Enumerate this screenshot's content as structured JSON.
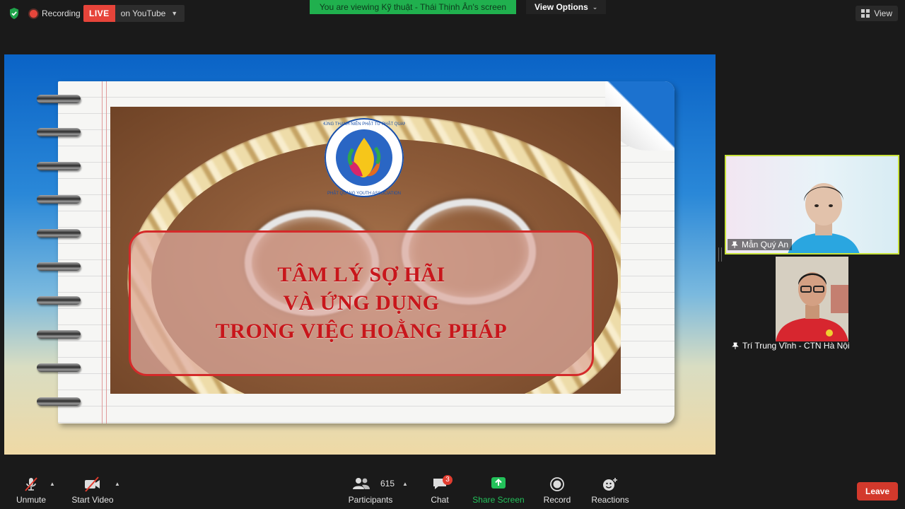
{
  "top_bar": {
    "recording_label": "Recording",
    "live_badge": "LIVE",
    "youtube_label": "on YouTube",
    "viewing_banner": "You are viewing Kỹ thuật - Thái Thịnh Ân's screen",
    "view_options": "View Options",
    "view_label": "View"
  },
  "slide": {
    "title_lines": [
      "TÂM LÝ SỢ HÃI",
      "VÀ ỨNG DỤNG",
      "TRONG VIỆC HOẰNG PHÁP"
    ],
    "logo_text_top": "CHÚNG THANH NIÊN PHẬT TỬ PHẬT QUANG",
    "logo_text_bottom": "PHẬT QUANG YOUTH ASSOCIATION"
  },
  "participants": [
    {
      "name": "Mẫn Quý An"
    },
    {
      "name": "Trí Trung Vĩnh - CTN Hà Nội"
    }
  ],
  "toolbar": {
    "unmute": "Unmute",
    "start_video": "Start Video",
    "participants_count": "615",
    "participants": "Participants",
    "chat": "Chat",
    "chat_badge": "3",
    "share_screen": "Share Screen",
    "record": "Record",
    "reactions": "Reactions",
    "leave": "Leave"
  },
  "colors": {
    "live_red": "#e6443a",
    "banner_green": "#20b04e",
    "share_green": "#23c15a",
    "leave_red": "#d3392c",
    "active_speaker_border": "#c8e23a",
    "title_red": "#c8161b"
  }
}
